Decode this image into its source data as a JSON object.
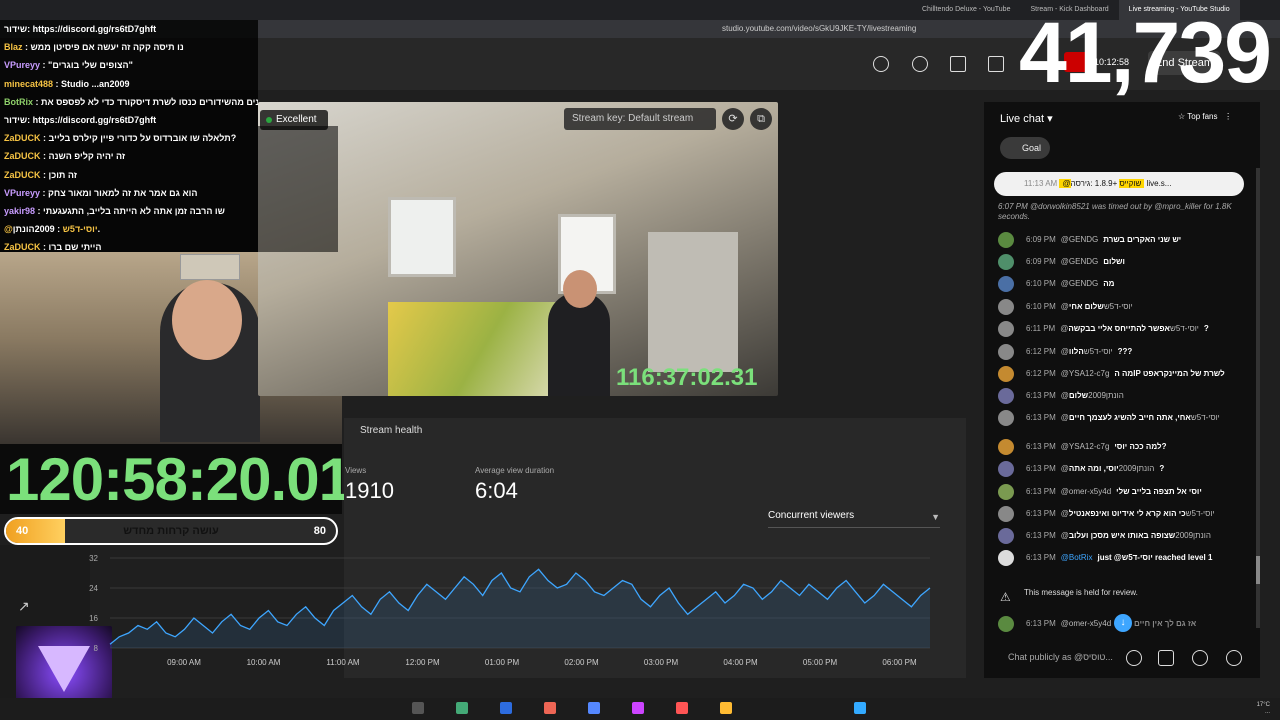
{
  "browser": {
    "tabs": [
      "Chilltendo Deluxe - YouTube",
      "Stream - Kick Dashboard",
      "Live streaming - YouTube Studio"
    ],
    "url": "studio.youtube.com/video/sGkU9JKE-TY/livestreaming"
  },
  "overlay": {
    "viewer_count": "41,739",
    "chat": [
      {
        "name": "",
        "msg": "שידור: https://discord.gg/rs6tD7ghft"
      },
      {
        "name": "Blaz",
        "msg": "נו תיסה קקה זה יעשה אם פיסיטן ממש"
      },
      {
        "name": "VPureyy",
        "msg": "\"הצופים שלי בוגרים\""
      },
      {
        "name": "minecat488",
        "msg": "Studio ...an2009"
      },
      {
        "name": "BotRix",
        "msg": "אם אתם נהנים מהשידורים כנסו לשרת דיסקורד כדי לא לפספס את"
      },
      {
        "name": "",
        "msg": "שידור: https://discord.gg/rs6tD7ghft"
      },
      {
        "name": "ZaDUCK",
        "msg": "תלאלה שו אוברדוס על כדורי פיין קילרס בלייב?"
      },
      {
        "name": "ZaDUCK",
        "msg": "זה יהיה קליפ השנה"
      },
      {
        "name": "ZaDUCK",
        "msg": "זה תוכן"
      },
      {
        "name": "VPureyy",
        "msg": "הוא גם אמר את זה למאור ומאור צחק"
      },
      {
        "name": "yakir98",
        "msg": "שו הרבה זמן אתה לא הייתה בלייב, התגעגעתי"
      },
      {
        "name": "@יוסי-ד5ש",
        "msg": "2009הונתן."
      },
      {
        "name": "ZaDUCK",
        "msg": "הייתי שם ברו"
      },
      {
        "name": "ZaDUCK",
        "msg": ":"
      }
    ],
    "big_timer": "120:58:20.01",
    "goal": {
      "start": "40",
      "end": "80",
      "label": "עושה קרחות מחדש",
      "progress": 0.18
    },
    "preview_timer": "116:37:02.31"
  },
  "studio": {
    "live_time": "10:12:58",
    "end_stream": "End Stream",
    "health_label": "Excellent",
    "stream_key": "Stream key: Default stream",
    "stream_health_title": "Stream health",
    "views_label": "Views",
    "views_value": "1910",
    "avg_label": "Average view duration",
    "avg_value": "6:04",
    "concurrent_label": "Concurrent viewers"
  },
  "chart_data": {
    "type": "line",
    "title": "",
    "xlabel": "",
    "ylabel": "",
    "ylim": [
      8,
      32
    ],
    "yticks": [
      32,
      24,
      16,
      8
    ],
    "xticks": [
      "09:00 AM",
      "10:00 AM",
      "11:00 AM",
      "12:00 PM",
      "01:00 PM",
      "02:00 PM",
      "03:00 PM",
      "04:00 PM",
      "05:00 PM",
      "06:00 PM"
    ],
    "series": [
      {
        "name": "",
        "values": [
          9,
          11,
          12,
          14,
          13,
          15,
          12,
          11,
          13,
          16,
          14,
          12,
          15,
          17,
          14,
          13,
          16,
          18,
          15,
          14,
          17,
          19,
          16,
          14,
          18,
          20,
          22,
          19,
          17,
          21,
          23,
          20,
          18,
          22,
          25,
          23,
          21,
          24,
          27,
          25,
          22,
          26,
          28,
          24,
          23,
          27,
          29,
          26,
          24,
          25,
          28,
          26,
          23,
          22,
          24,
          26,
          25,
          21,
          19,
          22,
          24,
          20,
          17,
          19,
          21,
          23,
          20,
          22,
          25,
          24,
          21,
          23,
          26,
          24,
          22,
          25,
          23,
          21,
          24,
          26,
          23,
          20,
          22,
          25,
          23,
          21,
          19,
          22,
          24
        ]
      }
    ]
  },
  "chat": {
    "title": "Live chat",
    "top_fans": "Top fans",
    "goal_label": "Goal",
    "pinned": {
      "time": "11:13 AM",
      "name": "@שוקייס",
      "msg": "+1.8.9 :גירסה live.s..."
    },
    "timeout_notice": "6:07 PM  @dorwolkin8521 was timed out by @mpro_killer for 1.8K seconds.",
    "messages": [
      {
        "time": "6:09 PM",
        "name": "@GENDG",
        "msg": "יש שני האקרים בשרת"
      },
      {
        "time": "6:09 PM",
        "name": "@GENDG",
        "msg": "ושלום"
      },
      {
        "time": "6:10 PM",
        "name": "@GENDG",
        "msg": "מה"
      },
      {
        "time": "6:10 PM",
        "name": "@יוסי-ד5ש",
        "msg": "שלום אחי"
      },
      {
        "time": "6:11 PM",
        "name": "@יוסי-ד5ש",
        "msg": "אפשר להתייחס אליי בבקשה?"
      },
      {
        "time": "6:12 PM",
        "name": "@יוסי-ד5ש",
        "msg": "הלוו???"
      },
      {
        "time": "6:12 PM",
        "name": "@YSA12-c7g",
        "msg": "מה הIP לשרת של המיינקראפט"
      },
      {
        "time": "6:13 PM",
        "name": "@הונתן2009",
        "msg": "שלום"
      },
      {
        "time": "6:13 PM",
        "name": "@יוסי-ד5ש",
        "msg": "אחי, אתה חייב להשיג לעצמך חיים"
      },
      {
        "time": "6:13 PM",
        "name": "@YSA12-c7g",
        "msg": "למה ככה יוסי?"
      },
      {
        "time": "6:13 PM",
        "name": "@הונתן2009",
        "msg": "יוסי, ומה אתה?"
      },
      {
        "time": "6:13 PM",
        "name": "@omer-x5y4d",
        "msg": "יוסי אל תצפה בלייב שלי"
      },
      {
        "time": "6:13 PM",
        "name": "@יוסי-ד5ש",
        "msg": "כי הוא קרא לי אידיוט ואינפאנטיל"
      },
      {
        "time": "6:13 PM",
        "name": "@הונתן2009",
        "msg": "שצופה באותו איש מסכן ועלוב"
      },
      {
        "time": "6:13 PM",
        "name": "@BotRix",
        "msg": "just @יוסי-ד5ש reached level 1"
      }
    ],
    "held_notice": "This message is held for review.",
    "held_msg": {
      "time": "6:13 PM",
      "name": "@omer-x5y4d",
      "msg": "אז גם לך אין חיים למה"
    },
    "input_placeholder": "Chat publicly as @טוסיס..."
  }
}
